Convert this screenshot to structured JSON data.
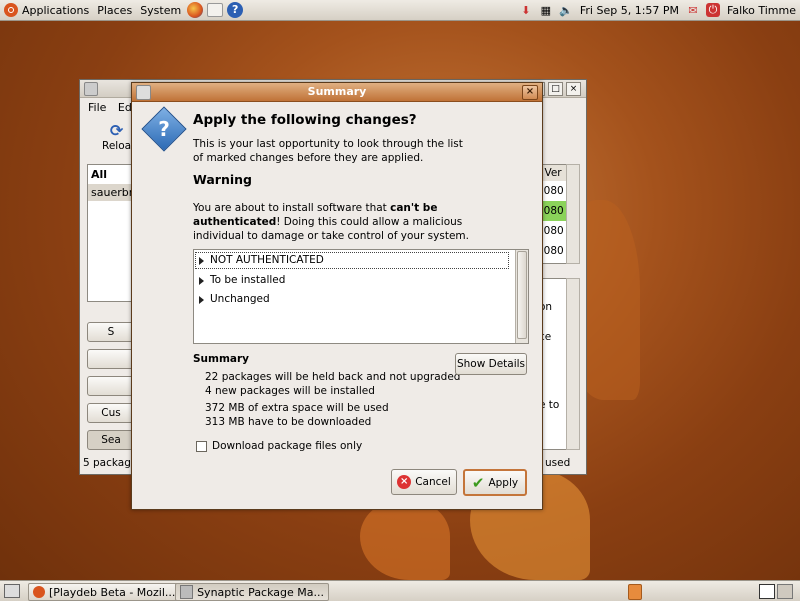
{
  "top_panel": {
    "menus": [
      "Applications",
      "Places",
      "System"
    ],
    "datetime": "Fri Sep  5,  1:57 PM",
    "user": "Falko Timme"
  },
  "bg_window": {
    "menu_file": "File",
    "menu_edit": "Edi",
    "reload": "Reloa",
    "list_header": "All",
    "list_item": "sauerbra",
    "col_header": "t Ver",
    "versions": [
      "0080",
      "0080",
      "0080",
      "0080"
    ],
    "desc_fragments": [
      "on",
      "ce",
      "e to"
    ],
    "side_buttons": [
      "S",
      "",
      "",
      "Cus",
      "Sea"
    ],
    "status_left": "5 package",
    "status_right": "used"
  },
  "dialog": {
    "title": "Summary",
    "heading": "Apply the following changes?",
    "intro_line1": "This is your last opportunity to look through the list",
    "intro_line2": "of marked changes before they are applied.",
    "warning_title": "Warning",
    "warning_line1_a": "You are about to install software that ",
    "warning_line1_b": "can't be",
    "warning_line2_a": "authenticated",
    "warning_line2_b": "! Doing this could allow a malicious",
    "warning_line3": "individual to damage or take control of your system.",
    "tree_items": [
      "NOT AUTHENTICATED",
      "To be installed",
      "Unchanged"
    ],
    "summary_title": "Summary",
    "summary_lines": [
      "22 packages will be held back and not upgraded",
      "4 new packages will be installed",
      "372 MB of extra space will be used",
      "313 MB have to be downloaded"
    ],
    "show_details": "Show Details",
    "download_only": "Download package files only",
    "cancel": "Cancel",
    "apply": "Apply"
  },
  "taskbar": {
    "tasks": [
      "[Playdeb Beta - Mozil...",
      "Synaptic Package Ma..."
    ]
  },
  "colors": {
    "dialog_title_start": "#e0b082",
    "dialog_title_end": "#c07237",
    "desktop": "#a4521c"
  }
}
